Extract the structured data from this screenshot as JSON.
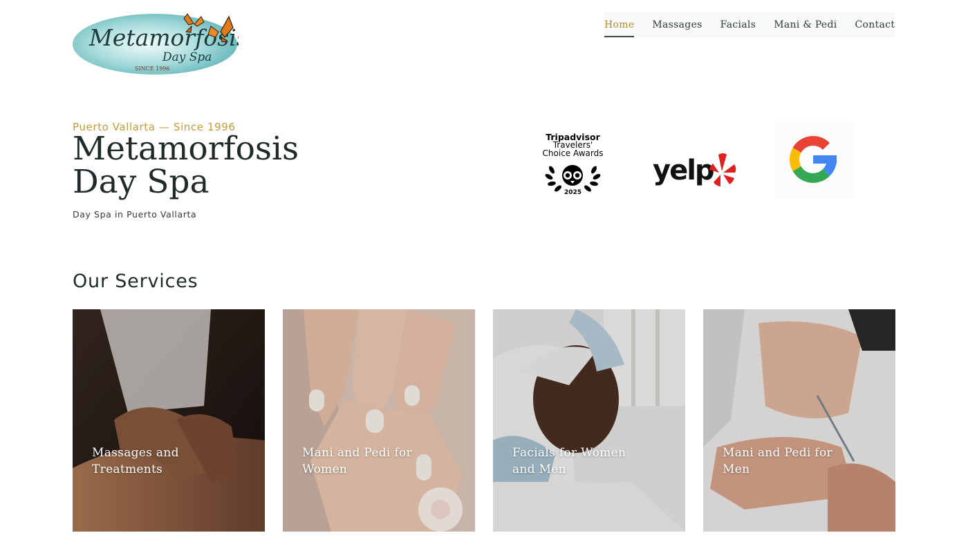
{
  "logo": {
    "name": "Metamorfosis",
    "sub": "Day Spa",
    "since": "SINCE 1996"
  },
  "nav": {
    "items": [
      {
        "label": "Home",
        "active": true
      },
      {
        "label": "Massages",
        "active": false
      },
      {
        "label": "Facials",
        "active": false
      },
      {
        "label": "Mani & Pedi",
        "active": false
      },
      {
        "label": "Contact",
        "active": false
      }
    ]
  },
  "hero": {
    "eyebrow": "Puerto Vallarta — Since 1996",
    "title_line1": "Metamorfosis",
    "title_line2": "Day Spa",
    "subtitle": "Day Spa in Puerto Vallarta"
  },
  "badges": {
    "tripadvisor": {
      "brand": "Tripadvisor",
      "line1": "Travelers'",
      "line2": "Choice Awards",
      "year": "2025"
    },
    "yelp": {
      "text": "yelp"
    },
    "google": {
      "icon": "google-g-icon"
    }
  },
  "services": {
    "title": "Our Services",
    "cards": [
      {
        "label": "Massages and Treatments",
        "image": "massage-photo"
      },
      {
        "label": "Mani and Pedi for Women",
        "image": "manicure-photo"
      },
      {
        "label": "Facials for Women and Men",
        "image": "facial-photo"
      },
      {
        "label": "Mani and Pedi for Men",
        "image": "mens-manicure-photo"
      }
    ]
  },
  "colors": {
    "accent_gold": "#c39a34",
    "nav_active": "#b28c2b",
    "heading": "#1f2b2a",
    "logo_teal": "#8fcfcf"
  }
}
